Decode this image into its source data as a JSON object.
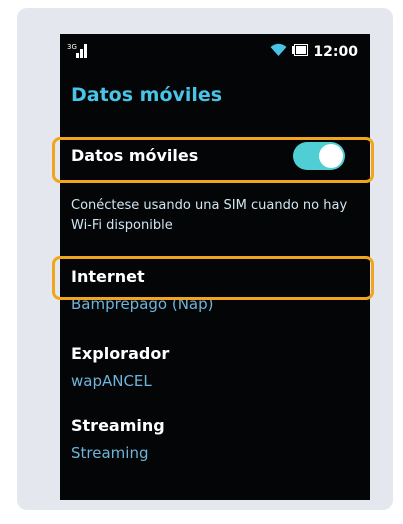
{
  "status_bar": {
    "signal_icon": "signal-bars-icon",
    "wifi_icon": "wifi-icon",
    "battery_icon": "battery-icon",
    "time": "12:00"
  },
  "screen": {
    "title": "Datos móviles"
  },
  "mobile_data": {
    "label": "Datos móviles",
    "toggle_state": "on",
    "toggle_color": "#4fcfd4",
    "description": "Conéctese usando una SIM cuando no hay Wi-Fi disponible"
  },
  "settings": [
    {
      "label": "Internet",
      "value": "Bamprepago (Nap)"
    },
    {
      "label": "Explorador",
      "value": "wapANCEL"
    },
    {
      "label": "Streaming",
      "value": "Streaming"
    }
  ],
  "colors": {
    "highlight": "#f0a51c",
    "title": "#49c3e6",
    "value_text": "#6fb4da",
    "screen_bg": "#040507",
    "card_bg": "#e4e8ee"
  }
}
